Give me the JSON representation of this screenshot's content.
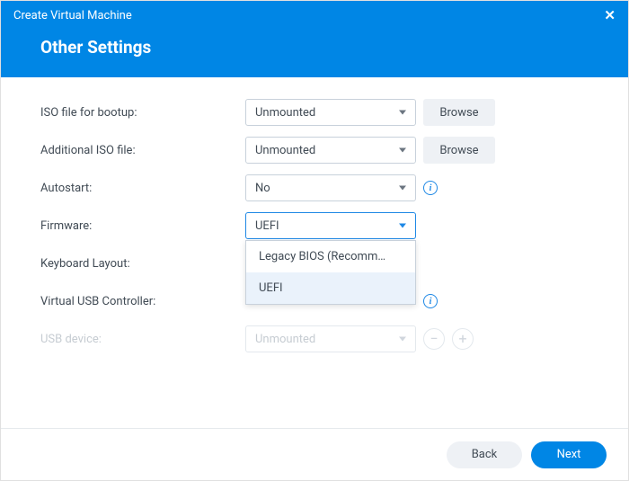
{
  "titlebar": {
    "title": "Create Virtual Machine",
    "close": "✕"
  },
  "subtitle": "Other Settings",
  "rows": {
    "iso": {
      "label": "ISO file for bootup:",
      "value": "Unmounted",
      "browse": "Browse"
    },
    "iso2": {
      "label": "Additional ISO file:",
      "value": "Unmounted",
      "browse": "Browse"
    },
    "autostart": {
      "label": "Autostart:",
      "value": "No"
    },
    "firmware": {
      "label": "Firmware:",
      "value": "UEFI",
      "options": {
        "legacy": "Legacy BIOS (Recomm…",
        "uefi": "UEFI"
      }
    },
    "keyboard": {
      "label": "Keyboard Layout:"
    },
    "usbctrl": {
      "label": "Virtual USB Controller:"
    },
    "usbdev": {
      "label": "USB device:",
      "value": "Unmounted"
    }
  },
  "footer": {
    "back": "Back",
    "next": "Next"
  },
  "icons": {
    "info": "i",
    "minus": "−",
    "plus": "+"
  }
}
